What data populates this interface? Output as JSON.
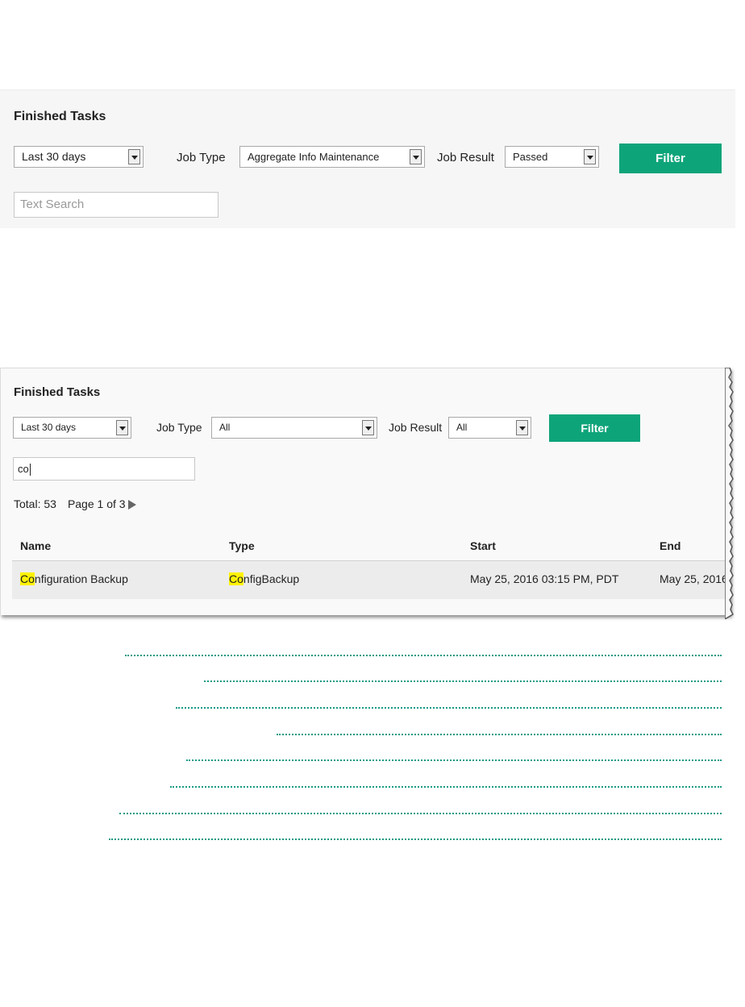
{
  "panel1": {
    "title": "Finished Tasks",
    "period": "Last 30 days",
    "job_type_label": "Job Type",
    "job_type_value": "Aggregate Info Maintenance",
    "job_result_label": "Job Result",
    "job_result_value": "Passed",
    "filter_button": "Filter",
    "search_placeholder": "Text Search"
  },
  "panel2": {
    "title": "Finished Tasks",
    "period": "Last 30 days",
    "job_type_label": "Job Type",
    "job_type_value": "All",
    "job_result_label": "Job Result",
    "job_result_value": "All",
    "filter_button": "Filter",
    "search_value": "co",
    "total": "Total: 53",
    "page": "Page 1 of 3",
    "columns": [
      "Name",
      "Type",
      "Start",
      "End"
    ],
    "rows": [
      {
        "name_highlight": "Co",
        "name_rest": "nfiguration Backup",
        "type_highlight": "Co",
        "type_rest": "nfigBackup",
        "start": "May 25, 2016 03:15 PM, PDT",
        "end": "May 25, 2016"
      }
    ]
  },
  "colors": {
    "filter_button": "#0ea47a",
    "highlight": "#fff200",
    "toc_dots": "#199a85"
  }
}
